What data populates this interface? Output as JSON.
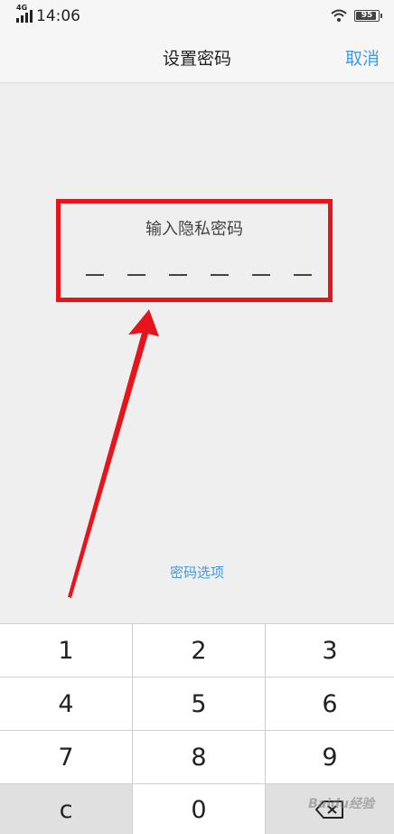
{
  "status_bar": {
    "network": "4G",
    "time": "14:06",
    "battery": "95",
    "battery_level": 0.95
  },
  "nav": {
    "title": "设置密码",
    "cancel_label": "取消"
  },
  "password": {
    "prompt": "输入隐私密码",
    "digit_count": 6
  },
  "options_link": "密码选项",
  "keypad": {
    "keys": [
      "1",
      "2",
      "3",
      "4",
      "5",
      "6",
      "7",
      "8",
      "9",
      "c",
      "0"
    ],
    "delete_icon": "backspace-icon"
  },
  "watermark": "Baidu经验",
  "colors": {
    "accent": "#3d9ae8",
    "highlight": "#e8141b"
  }
}
